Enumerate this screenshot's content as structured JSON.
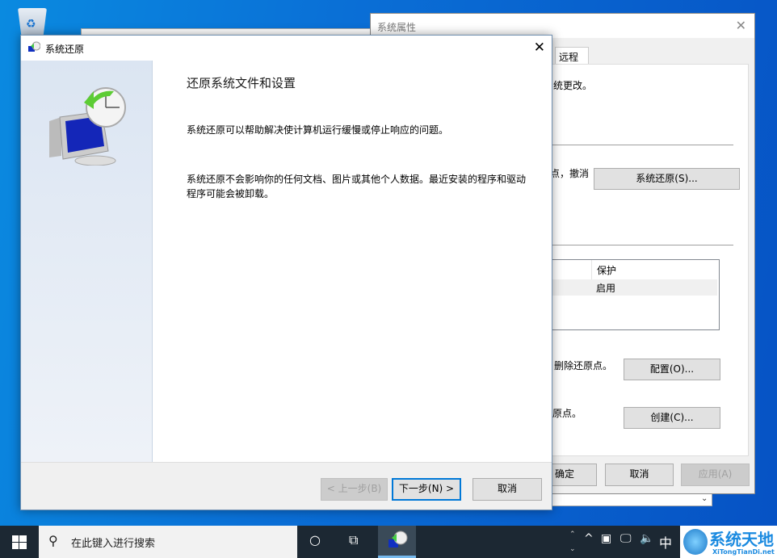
{
  "desktop": {
    "icons": [
      "recycle-bin"
    ]
  },
  "system_properties": {
    "title": "系统属性",
    "tab": "远程",
    "text1": "统更改。",
    "text2": "点，撤消",
    "system_restore_button": "系统还原(S)...",
    "list_header": "保护",
    "list_row": "启用",
    "text3": "删除还原点。",
    "configure_button": "配置(O)...",
    "text4": "原点。",
    "create_button": "创建(C)...",
    "ok": "确定",
    "cancel": "取消",
    "apply": "应用(A)"
  },
  "restore_wizard": {
    "title": "系统还原",
    "heading": "还原系统文件和设置",
    "para1": "系统还原可以帮助解决使计算机运行缓慢或停止响应的问题。",
    "para2": "系统还原不会影响你的任何文档、图片或其他个人数据。最近安装的程序和驱动程序可能会被卸载。",
    "back": "< 上一步(B)",
    "next": "下一步(N) >",
    "cancel": "取消"
  },
  "taskbar": {
    "search_placeholder": "在此键入进行搜索",
    "ime": "中",
    "watermark": "系统天地",
    "watermark_url": "XiTongTianDi.net"
  }
}
